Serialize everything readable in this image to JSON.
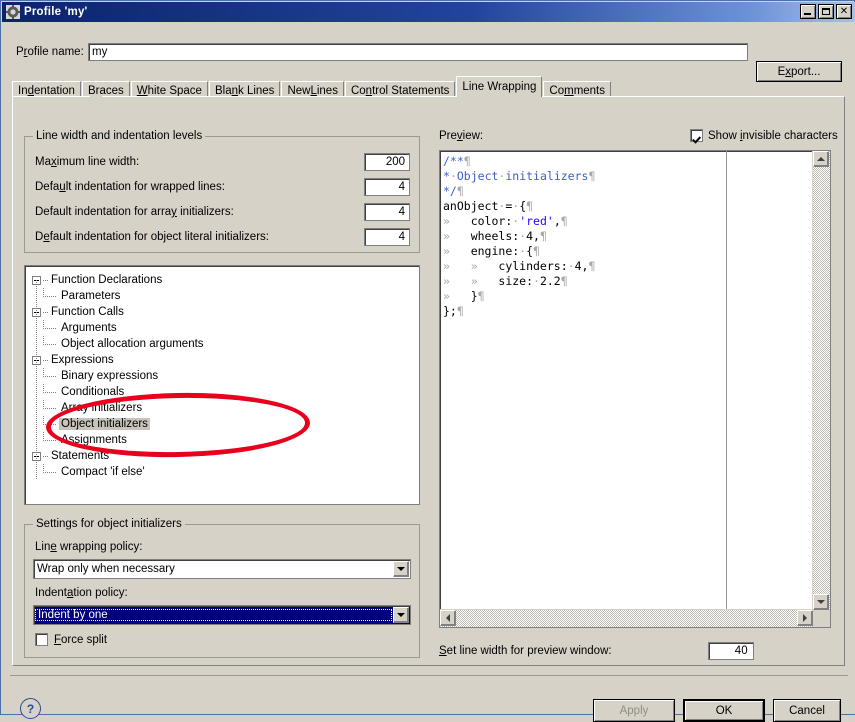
{
  "window": {
    "title": "Profile 'my'",
    "icon": "gear-icon",
    "minimize": "_",
    "maximize": "□",
    "close": "✕"
  },
  "profile": {
    "label_pre": "P",
    "label_mn": "r",
    "label_post": "ofile name:",
    "value": "my",
    "export_pre": "E",
    "export_mn": "x",
    "export_post": "port..."
  },
  "tabs": [
    {
      "pre": "In",
      "mn": "d",
      "post": "entation",
      "active": false
    },
    {
      "pre": "B",
      "mn": "r",
      "post": "aces",
      "active": false
    },
    {
      "pre": "",
      "mn": "W",
      "post": "hite Space",
      "active": false
    },
    {
      "pre": "Bla",
      "mn": "n",
      "post": "k Lines",
      "active": false
    },
    {
      "pre": "New ",
      "mn": "L",
      "post": "ines",
      "active": false
    },
    {
      "pre": "Co",
      "mn": "n",
      "post": "trol Statements",
      "active": false
    },
    {
      "pre": "Line Wrappin",
      "mn": "g",
      "post": "",
      "active": true
    },
    {
      "pre": "Co",
      "mn": "m",
      "post": "ments",
      "active": false
    }
  ],
  "line_width_group": {
    "title": "Line width and indentation levels",
    "rows": [
      {
        "pre": "Ma",
        "mn": "x",
        "post": "imum line width:",
        "value": "200"
      },
      {
        "pre": "Defa",
        "mn": "u",
        "post": "lt indentation for wrapped lines:",
        "value": "4"
      },
      {
        "pre": "Default indentation for arra",
        "mn": "y",
        "post": " initializers:",
        "value": "4"
      },
      {
        "pre": "D",
        "mn": "e",
        "post": "fault indentation for object literal initializers:",
        "value": "4"
      }
    ]
  },
  "tree": {
    "nodes": [
      {
        "label": "Function Declarations",
        "level": 0,
        "expander": true,
        "selected": false
      },
      {
        "label": "Parameters",
        "level": 1,
        "expander": false,
        "selected": false
      },
      {
        "label": "Function Calls",
        "level": 0,
        "expander": true,
        "selected": false
      },
      {
        "label": "Arguments",
        "level": 1,
        "expander": false,
        "selected": false
      },
      {
        "label": "Object allocation arguments",
        "level": 1,
        "expander": false,
        "selected": false
      },
      {
        "label": "Expressions",
        "level": 0,
        "expander": true,
        "selected": false
      },
      {
        "label": "Binary expressions",
        "level": 1,
        "expander": false,
        "selected": false
      },
      {
        "label": "Conditionals",
        "level": 1,
        "expander": false,
        "selected": false
      },
      {
        "label": "Array initializers",
        "level": 1,
        "expander": false,
        "selected": false
      },
      {
        "label": "Object initializers",
        "level": 1,
        "expander": false,
        "selected": true
      },
      {
        "label": "Assignments",
        "level": 1,
        "expander": false,
        "selected": false
      },
      {
        "label": "Statements",
        "level": 0,
        "expander": true,
        "selected": false
      },
      {
        "label": "Compact 'if else'",
        "level": 1,
        "expander": false,
        "selected": false
      }
    ]
  },
  "settings_group": {
    "title": "Settings for object initializers",
    "wrapping_label_pre": "Lin",
    "wrapping_label_mn": "e",
    "wrapping_label_post": " wrapping policy:",
    "wrapping_value": "Wrap only when necessary",
    "indent_label_pre": "Indent",
    "indent_label_mn": "a",
    "indent_label_post": "tion policy:",
    "indent_value": "Indent by one",
    "force_split_pre": "",
    "force_split_mn": "F",
    "force_split_post": "orce split",
    "force_split_checked": false
  },
  "preview": {
    "label_pre": "Pre",
    "label_mn": "v",
    "label_post": "iew:",
    "invisible_pre": "Show ",
    "invisible_mn": "i",
    "invisible_post": "nvisible characters",
    "invisible_checked": true,
    "code_lines": [
      [
        {
          "t": "/**",
          "c": "cm"
        },
        {
          "t": "¶",
          "c": "inv"
        }
      ],
      [
        {
          "t": "*",
          "c": "cm"
        },
        {
          "t": "·",
          "c": "inv"
        },
        {
          "t": "Object",
          "c": "cm"
        },
        {
          "t": "·",
          "c": "inv"
        },
        {
          "t": "initializers",
          "c": "cm"
        },
        {
          "t": "¶",
          "c": "inv"
        }
      ],
      [
        {
          "t": "*/",
          "c": "cm"
        },
        {
          "t": "¶",
          "c": "inv"
        }
      ],
      [
        {
          "t": "anObject",
          "c": ""
        },
        {
          "t": "·",
          "c": "inv"
        },
        {
          "t": "=",
          "c": ""
        },
        {
          "t": "·",
          "c": "inv"
        },
        {
          "t": "{",
          "c": ""
        },
        {
          "t": "¶",
          "c": "inv"
        }
      ],
      [
        {
          "t": "»   ",
          "c": "inv"
        },
        {
          "t": "color:",
          "c": ""
        },
        {
          "t": "·",
          "c": "inv"
        },
        {
          "t": "'red'",
          "c": "str"
        },
        {
          "t": ",",
          "c": ""
        },
        {
          "t": "¶",
          "c": "inv"
        }
      ],
      [
        {
          "t": "»   ",
          "c": "inv"
        },
        {
          "t": "wheels:",
          "c": ""
        },
        {
          "t": "·",
          "c": "inv"
        },
        {
          "t": "4,",
          "c": ""
        },
        {
          "t": "¶",
          "c": "inv"
        }
      ],
      [
        {
          "t": "»   ",
          "c": "inv"
        },
        {
          "t": "engine:",
          "c": ""
        },
        {
          "t": "·",
          "c": "inv"
        },
        {
          "t": "{",
          "c": ""
        },
        {
          "t": "¶",
          "c": "inv"
        }
      ],
      [
        {
          "t": "»   »   ",
          "c": "inv"
        },
        {
          "t": "cylinders:",
          "c": ""
        },
        {
          "t": "·",
          "c": "inv"
        },
        {
          "t": "4,",
          "c": ""
        },
        {
          "t": "¶",
          "c": "inv"
        }
      ],
      [
        {
          "t": "»   »   ",
          "c": "inv"
        },
        {
          "t": "size:",
          "c": ""
        },
        {
          "t": "·",
          "c": "inv"
        },
        {
          "t": "2.2",
          "c": ""
        },
        {
          "t": "¶",
          "c": "inv"
        }
      ],
      [
        {
          "t": "»   ",
          "c": "inv"
        },
        {
          "t": "}",
          "c": ""
        },
        {
          "t": "¶",
          "c": "inv"
        }
      ],
      [
        {
          "t": "};",
          "c": ""
        },
        {
          "t": "¶",
          "c": "inv"
        }
      ]
    ],
    "linewidth_label_pre": "",
    "linewidth_label_mn": "S",
    "linewidth_label_post": "et line width for preview window:",
    "linewidth_value": "40"
  },
  "footer": {
    "help": "?",
    "apply": "Apply",
    "ok": "OK",
    "cancel": "Cancel"
  },
  "annotation": {
    "shape": "red-oval",
    "color": "#e8001c"
  }
}
